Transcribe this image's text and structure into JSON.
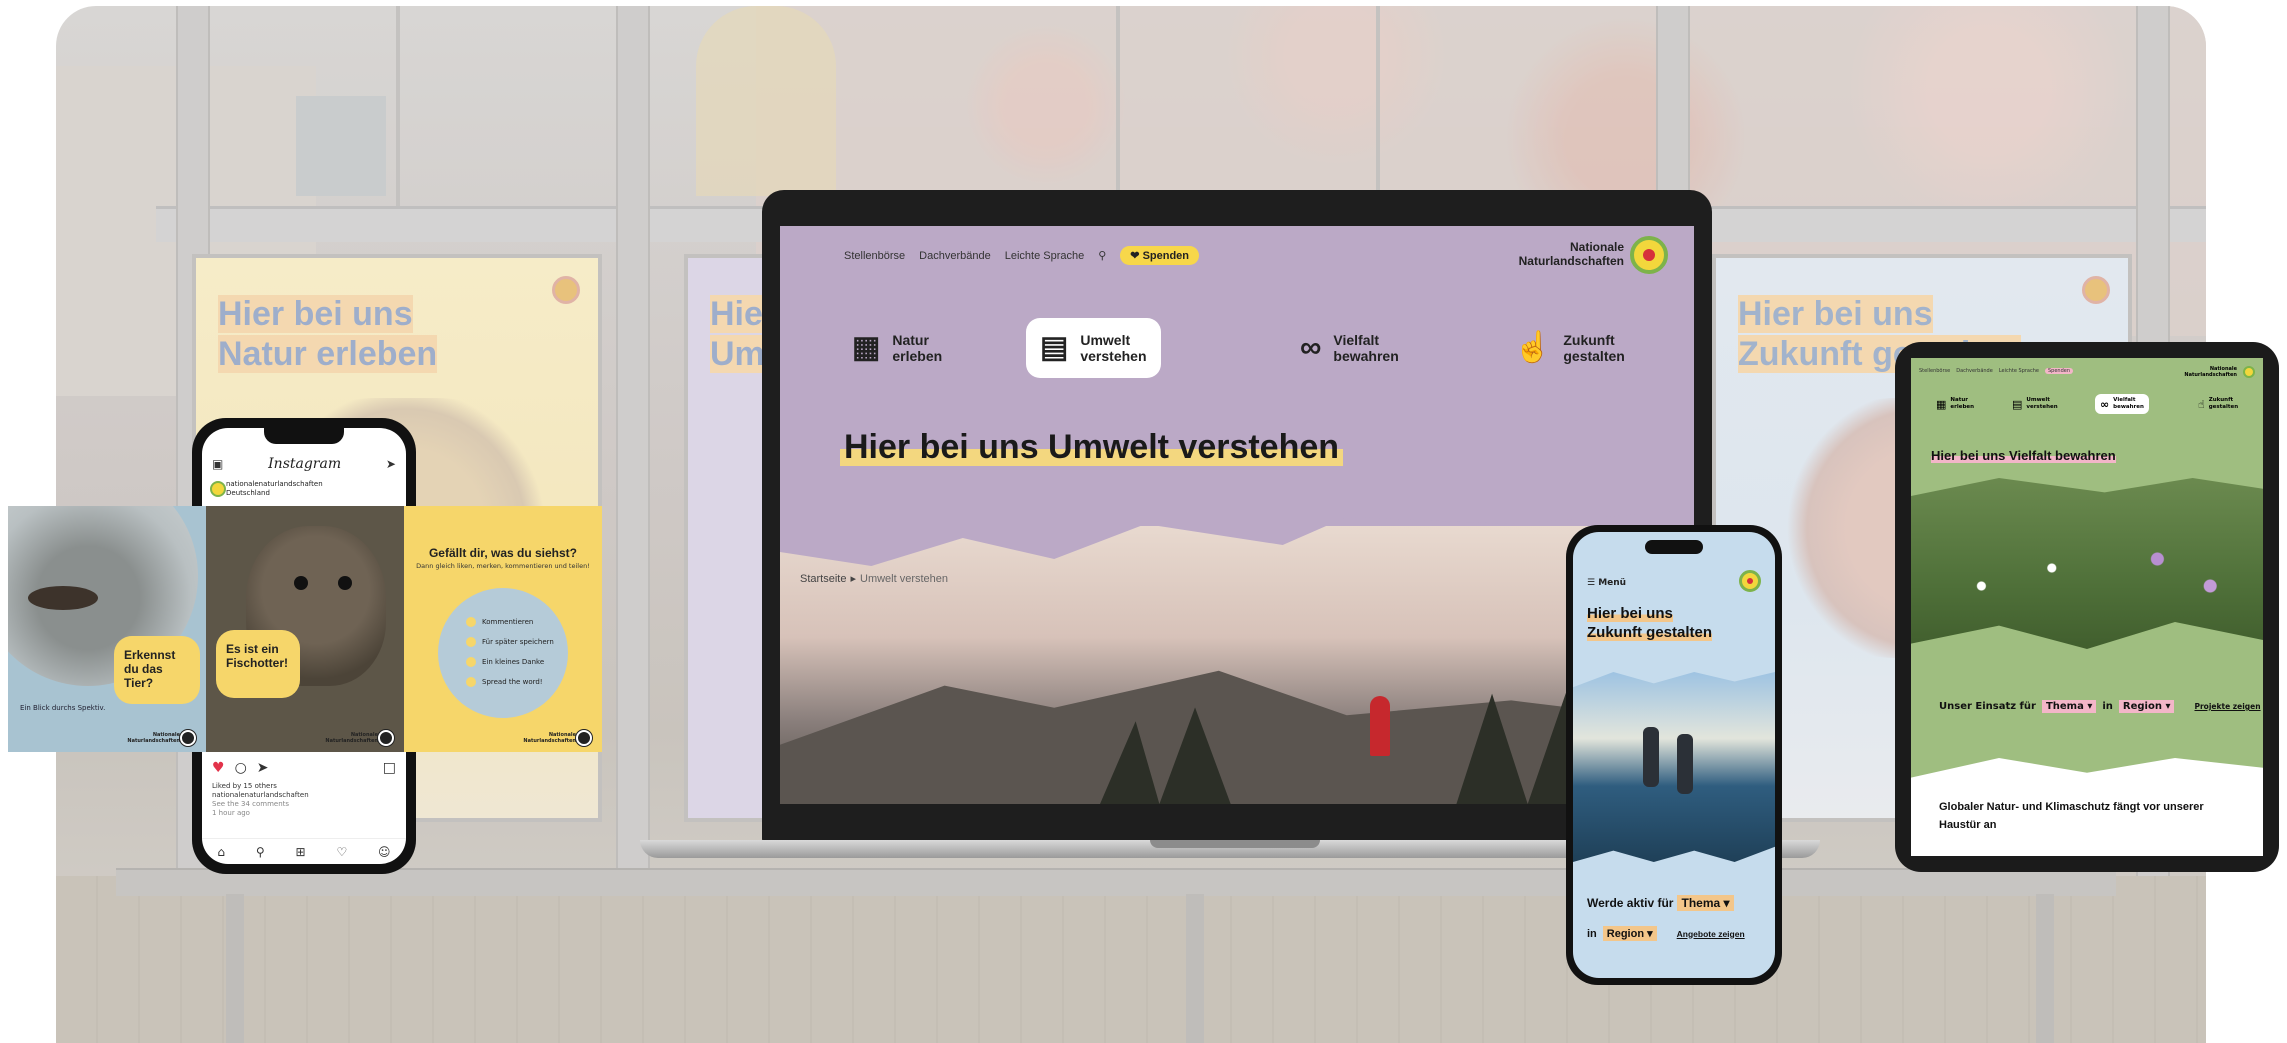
{
  "colors": {
    "laptop_bg": "#bba9c6",
    "phone_bg": "#c6dced",
    "tablet_bg": "#9fbe80",
    "accent_yellow": "#f7d74a",
    "accent_orange": "#f3c68a",
    "accent_pink": "#f3b6c8"
  },
  "posters": [
    {
      "title_1": "Hier bei uns",
      "title_2": "Natur erleben"
    },
    {
      "title_1": "Hie",
      "title_2": "Um"
    },
    {
      "title_1": "Hier bei uns",
      "title_2": "Zukunft gestalten"
    }
  ],
  "laptop": {
    "nav": {
      "stellenboerse": "Stellenbörse",
      "dachverbaende": "Dachverbände",
      "leichte_sprache": "Leichte Sprache",
      "search_icon": "search-icon",
      "spenden": "Spenden"
    },
    "brand": {
      "line1": "Nationale",
      "line2": "Naturlandschaften"
    },
    "tiles": [
      {
        "l1": "Natur",
        "l2": "erleben",
        "icon": "map-icon"
      },
      {
        "l1": "Umwelt",
        "l2": "verstehen",
        "icon": "book-icon",
        "active": true
      },
      {
        "l1": "Vielfalt",
        "l2": "bewahren",
        "icon": "binoculars-icon"
      },
      {
        "l1": "Zukunft",
        "l2": "gestalten",
        "icon": "thumbs-up-icon"
      }
    ],
    "title": "Hier bei uns Umwelt verstehen",
    "breadcrumb": {
      "home": "Startseite",
      "current": "Umwelt verstehen"
    }
  },
  "instagram": {
    "app_name": "Instagram",
    "account": "nationalenaturlandschaften",
    "location": "Deutschland",
    "cards": [
      {
        "bubble": "Erkennst du das Tier?",
        "footer": "Ein Blick durchs Spektiv."
      },
      {
        "bubble": "Es ist ein Fischotter!"
      },
      {
        "question": "Gefällt dir, was du siehst?",
        "sub": "Dann gleich liken, merken, kommentieren und teilen!",
        "items": [
          "Kommentieren",
          "Für später speichern",
          "Ein kleines Danke",
          "Spread the word!"
        ]
      }
    ],
    "tiny_logo": {
      "l1": "Nationale",
      "l2": "Naturlandschaften"
    },
    "liked_by": "Liked by 15 others",
    "caption_account": "nationalenaturlandschaften",
    "comments": "See the 34 comments",
    "time": "1 hour ago"
  },
  "phone": {
    "menu": "Menü",
    "title_1": "Hier bei uns",
    "title_2": "Zukunft gestalten",
    "cta_prefix": "Werde aktiv für",
    "thema": "Thema",
    "in": "in",
    "region": "Region",
    "link": "Angebote zeigen"
  },
  "tablet": {
    "nav": [
      "Stellenbörse",
      "Dachverbände",
      "Leichte Sprache"
    ],
    "spenden": "Spenden",
    "brand": {
      "l1": "Nationale",
      "l2": "Naturlandschaften"
    },
    "tiles": [
      {
        "l1": "Natur",
        "l2": "erleben",
        "icon": "map-icon"
      },
      {
        "l1": "Umwelt",
        "l2": "verstehen",
        "icon": "book-icon"
      },
      {
        "l1": "Vielfalt",
        "l2": "bewahren",
        "icon": "binoculars-icon",
        "active": true
      },
      {
        "l1": "Zukunft",
        "l2": "gestalten",
        "icon": "thumbs-up-icon"
      }
    ],
    "title": "Hier bei uns Vielfalt bewahren",
    "filter_prefix": "Unser Einsatz für",
    "thema": "Thema",
    "in": "in",
    "region": "Region",
    "link": "Projekte zeigen",
    "body": "Globaler Natur- und Klimaschutz fängt vor unserer Haustür an"
  }
}
